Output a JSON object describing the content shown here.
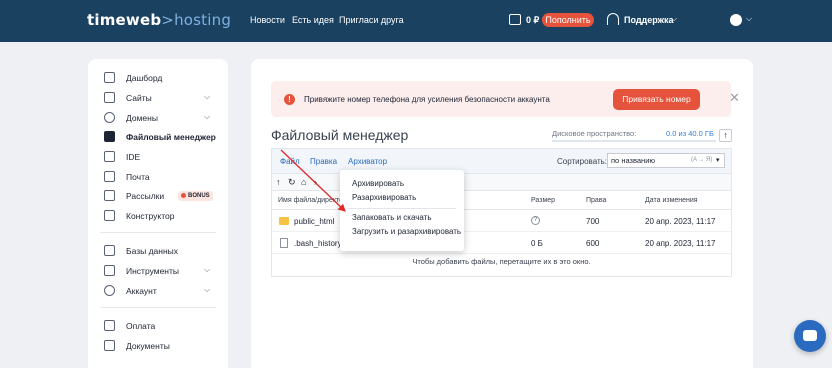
{
  "header": {
    "logo_brand": "timeweb",
    "logo_sep": ">",
    "logo_product": "hosting",
    "nav": [
      "Новости",
      "Есть идея",
      "Пригласи друга"
    ],
    "balance": "0 ₽",
    "topup": "Пополнить",
    "support": "Поддержка",
    "chevron": "⌵"
  },
  "sidebar": {
    "items": [
      {
        "label": "Дашборд"
      },
      {
        "label": "Сайты"
      },
      {
        "label": "Домены"
      },
      {
        "label": "Файловый менеджер"
      },
      {
        "label": "IDE"
      },
      {
        "label": "Почта"
      },
      {
        "label": "Рассылки"
      },
      {
        "label": "Конструктор"
      },
      {
        "label": "Базы данных"
      },
      {
        "label": "Инструменты"
      },
      {
        "label": "Аккаунт"
      },
      {
        "label": "Оплата"
      },
      {
        "label": "Документы"
      }
    ],
    "bonus": "BONUS",
    "active": "Файловый менеджер"
  },
  "alert": {
    "text": "Привяжите номер телефона для усиления безопасности аккаунта",
    "button": "Привязать номер",
    "close": "✕",
    "icon": "!"
  },
  "file_manager": {
    "title": "Файловый менеджер",
    "disk_label": "Дисковое пространство:",
    "disk_value": "0.0 из 40.0 ГБ",
    "disk_used_fraction": 0.0,
    "up_icon": "↑",
    "menus": [
      "Файл",
      "Правка",
      "Архиватор"
    ],
    "sort_label": "Сортировать:",
    "sort_value": "по названию",
    "sort_hint": "(A → Я)",
    "sort_arrow": "▾",
    "toolbar_icons": [
      "↑",
      "↻",
      "⌂",
      "›"
    ],
    "columns": [
      "Имя файла/директории",
      "Размер",
      "Права",
      "Дата изменения"
    ],
    "rows": [
      {
        "name": "public_html",
        "size": "?",
        "perms": "700",
        "date": "20 апр. 2023, 11:17",
        "type": "folder"
      },
      {
        "name": ".bash_history",
        "size": "0 Б",
        "perms": "600",
        "date": "20 апр. 2023, 11:17",
        "type": "file"
      }
    ],
    "drop_hint": "Чтобы добавить файлы, перетащите их в это окно."
  },
  "dropdown": {
    "items": [
      "Архивировать",
      "Разархивировать",
      "Запаковать и скачать",
      "Загрузить и разархивировать"
    ]
  },
  "colors": {
    "header_bg": "#1a4160",
    "accent": "#e5533c",
    "link": "#2b6bbf"
  }
}
